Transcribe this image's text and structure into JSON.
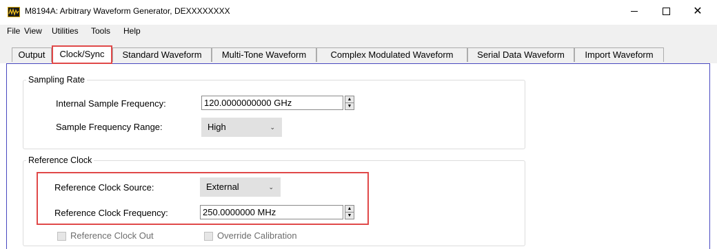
{
  "window": {
    "title": "M8194A: Arbitrary Waveform Generator, DEXXXXXXXX",
    "icon": "awg-waveform-icon",
    "controls": [
      "minimize-icon",
      "maximize-icon",
      "close-icon"
    ],
    "close_glyph": "✕"
  },
  "menu": [
    "File",
    "View",
    "Utilities",
    "Tools",
    "Help"
  ],
  "tabs": [
    "Output",
    "Clock/Sync",
    "Standard Waveform",
    "Multi-Tone Waveform",
    "Complex Modulated Waveform",
    "Serial Data Waveform",
    "Import Waveform"
  ],
  "active_tab": "Clock/Sync",
  "sampling_rate": {
    "legend": "Sampling Rate",
    "internal_freq_label": "Internal Sample Frequency:",
    "internal_freq_value": "120.0000000000 GHz",
    "freq_range_label": "Sample Frequency Range:",
    "freq_range_value": "High"
  },
  "reference_clock": {
    "legend": "Reference Clock",
    "source_label": "Reference Clock Source:",
    "source_value": "External",
    "frequency_label": "Reference Clock Frequency:",
    "frequency_value": "250.0000000 MHz",
    "clock_out_label": "Reference Clock Out",
    "override_label": "Override Calibration"
  },
  "glyphs": {
    "spin_up": "▲",
    "spin_down": "▼",
    "dropdown": "⌄"
  },
  "colors": {
    "highlight": "#e04848",
    "frame": "#4848c0"
  }
}
